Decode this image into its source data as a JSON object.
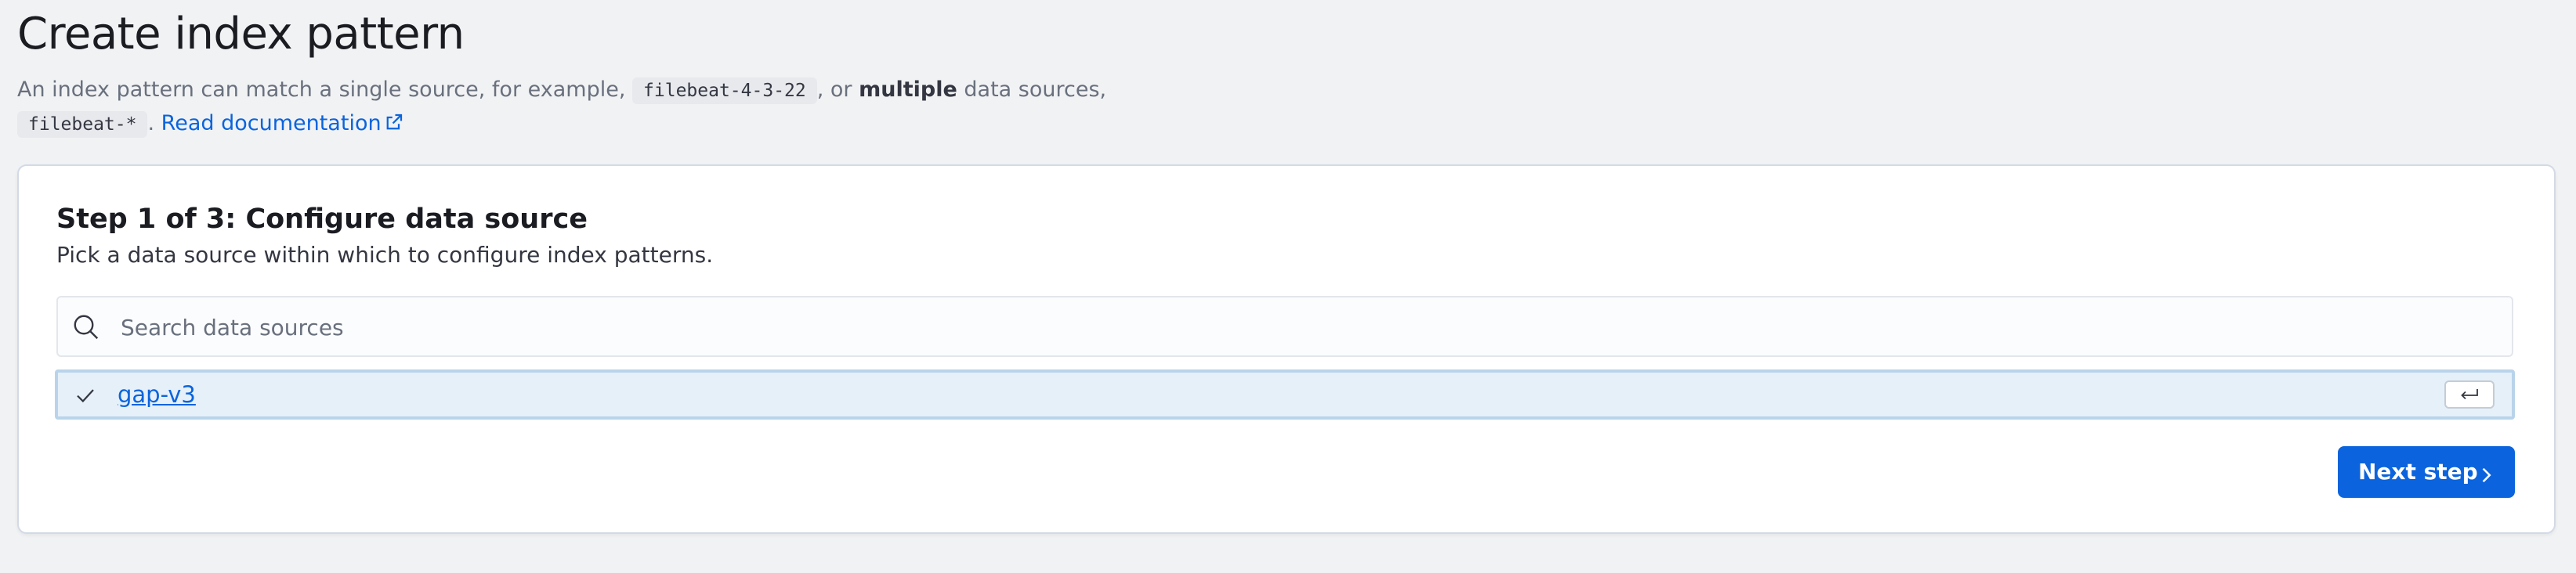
{
  "page": {
    "title": "Create index pattern",
    "description": {
      "part1": "An index pattern can match a single source, for example, ",
      "code_example1": "filebeat-4-3-22",
      "part2": ", or ",
      "bold_multiple": "multiple",
      "part3": " data sources, ",
      "code_example2": "filebeat-*",
      "part4": ". ",
      "link_label": "Read documentation"
    }
  },
  "step": {
    "title": "Step 1 of 3: Configure data source",
    "subtitle": "Pick a data source within which to configure index patterns.",
    "search": {
      "value": "",
      "placeholder": "Search data sources"
    },
    "options": [
      {
        "label": "gap-v3",
        "selected": true
      }
    ],
    "next_label": "Next step"
  },
  "icons": {
    "search": "search-icon",
    "external_link": "external-link-icon",
    "check": "check-icon",
    "enter": "enter-key-icon",
    "chevron": "chevron-right-icon"
  },
  "colors": {
    "accent": "#0b64dd",
    "page_background": "#f1f2f4",
    "selected_row": "#e6f0f8"
  }
}
